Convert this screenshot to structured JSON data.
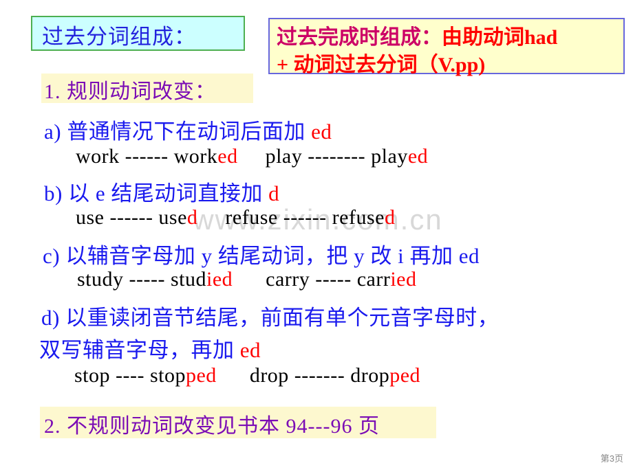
{
  "slide": {
    "page_label": "第3页",
    "watermark": "www.zixin.com.cn",
    "colors": {
      "blue_text": "#1a1aee",
      "red_text": "#ff0000",
      "purple_text": "#7b0cb5",
      "magenta_text": "#cc0066",
      "black_text": "#000000",
      "left_box_fill": "#ccffff",
      "left_box_border": "#4caf50",
      "right_box_fill": "#ffffcc",
      "right_box_border": "#6666dd",
      "highlight_band": "#fdf8cf",
      "watermark_gray": "#d8d8d8"
    }
  },
  "title_left": {
    "text": "过去分词组成："
  },
  "title_right": {
    "line1_part1": "过去完成时组成：",
    "line1_part2": "由助动词had",
    "line2": "+ 动词过去分词（V.pp)"
  },
  "sections": {
    "section1_heading": "1. 规则动词改变：",
    "section2_heading": "2. 不规则动词改变见书本 94---96 页"
  },
  "rules": [
    {
      "id": "a",
      "text_main": "a)  普通情况下在动词后面加 ",
      "text_suffix": "ed",
      "examples": [
        {
          "base": "work ------ work",
          "suffix": "ed"
        },
        {
          "base": "play -------- play",
          "suffix": "ed"
        }
      ],
      "example_line": "work ------ worked     play -------- played"
    },
    {
      "id": "b",
      "text_main": "b) 以 e 结尾动词直接加 ",
      "text_suffix": "d",
      "examples": [
        {
          "base": "use ------ use",
          "suffix": "d"
        },
        {
          "base": "refuse ------ refuse",
          "suffix": "d"
        }
      ],
      "example_line": "use ------ used     refuse ------ refused"
    },
    {
      "id": "c",
      "text_main": "c) 以辅音字母加 y 结尾动词，把 y 改  i 再加 ed",
      "text_suffix": "",
      "examples": [
        {
          "base": "study ----- stud",
          "suffix": "ied"
        },
        {
          "base": "carry ----- carr",
          "suffix": "ied"
        }
      ],
      "example_line": "study ----- studied     carry ----- carried"
    },
    {
      "id": "d",
      "text_main": "d) 以重读闭音节结尾，前面有单个元音字母时，",
      "text_line2_main": "双写辅音字母，再加 ",
      "text_suffix": "ed",
      "examples": [
        {
          "base": "stop ---- stop",
          "suffix": "ped"
        },
        {
          "base": "drop ------- drop",
          "suffix": "ped"
        }
      ],
      "example_line": "stop ---- stopped     drop ------- dropped"
    }
  ]
}
